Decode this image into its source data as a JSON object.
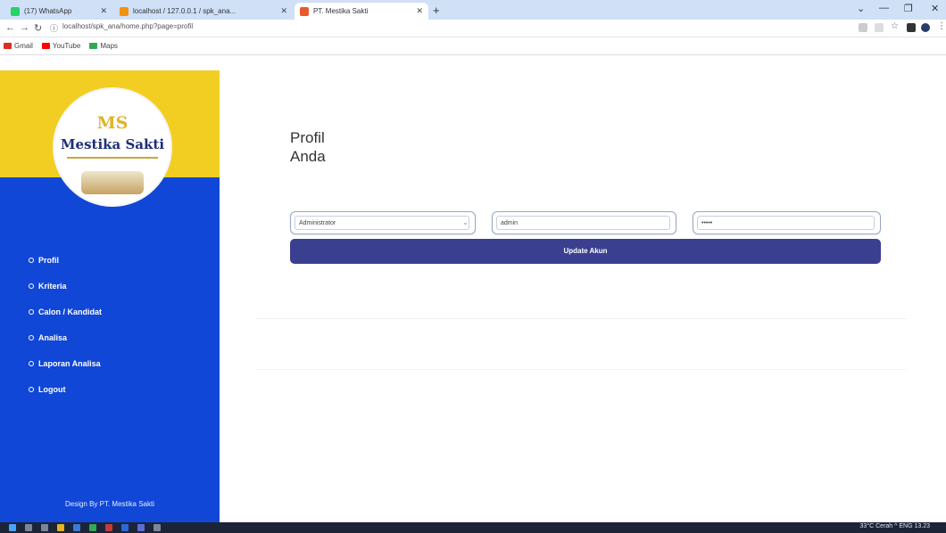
{
  "browser": {
    "tabs": [
      {
        "label": "(17) WhatsApp",
        "favicon_color": "#25d366"
      },
      {
        "label": "localhost / 127.0.0.1 / spk_ana...",
        "favicon_color": "#f29111"
      },
      {
        "label": "PT. Mestika Sakti",
        "favicon_color": "#e85a2a"
      }
    ],
    "url": "localhost/spk_ana/home.php?page=profil",
    "bookmarks": [
      {
        "label": "Gmail",
        "color": "#d93025"
      },
      {
        "label": "YouTube",
        "color": "#ff0000"
      },
      {
        "label": "Maps",
        "color": "#34a853"
      }
    ]
  },
  "sidebar": {
    "logo_initials": "MS",
    "logo_name": "Mestika Sakti",
    "menu": [
      {
        "label": "Profil"
      },
      {
        "label": "Kriteria"
      },
      {
        "label": "Calon / Kandidat"
      },
      {
        "label": "Analisa"
      },
      {
        "label": "Laporan Analisa"
      },
      {
        "label": "Logout"
      }
    ],
    "credit": "Design By PT. Mestika Sakti"
  },
  "main": {
    "title_line1": "Profil",
    "title_line2": "Anda",
    "fields": [
      {
        "value": "Administrator",
        "type": "select"
      },
      {
        "value": "admin",
        "type": "text"
      },
      {
        "value": "•••••",
        "type": "password"
      }
    ],
    "update_label": "Update Akun"
  },
  "taskbar": {
    "tray_text": "33°C  Cerah  ^  ENG  13.23"
  },
  "colors": {
    "sidebar_blue": "#1147d6",
    "sidebar_yellow": "#f3ce22",
    "button": "#3b3f8f"
  }
}
